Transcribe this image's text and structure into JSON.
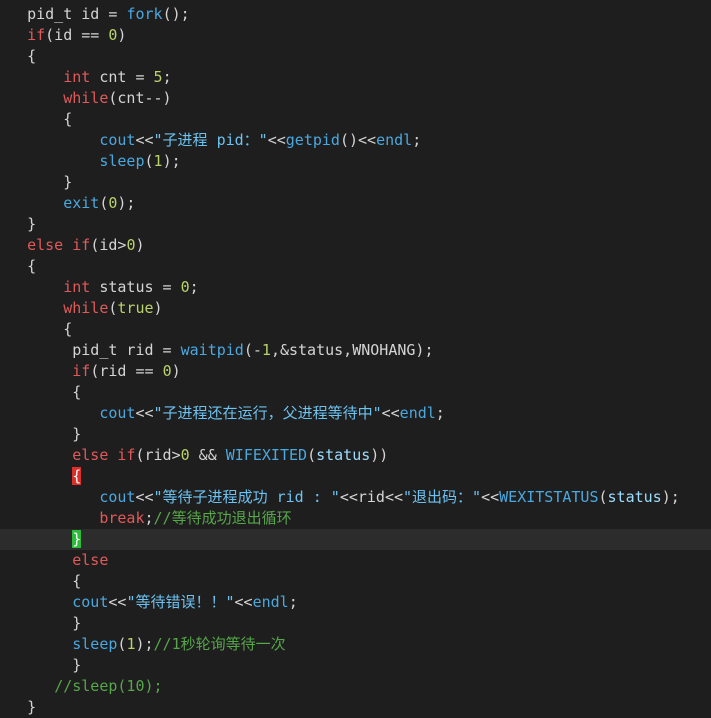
{
  "colors": {
    "background": "#1e1e1e",
    "current_line": "#2c2c2c",
    "plain": "#d4d4d4",
    "keyword": "#e05a5a",
    "function": "#4aa8e0",
    "number": "#b8d36a",
    "string": "#6cc2f0",
    "comment": "#57a64a",
    "bracket_match_open": "#d9302c",
    "bracket_match_close": "#2bbd3a"
  },
  "current_line_index": 25,
  "lines": [
    [
      {
        "t": "   pid_t id = ",
        "c": "pl"
      },
      {
        "t": "fork",
        "c": "fn"
      },
      {
        "t": "();",
        "c": "pl"
      }
    ],
    [
      {
        "t": "   ",
        "c": "pl"
      },
      {
        "t": "if",
        "c": "kw"
      },
      {
        "t": "(id == ",
        "c": "pl"
      },
      {
        "t": "0",
        "c": "num"
      },
      {
        "t": ")",
        "c": "pl"
      }
    ],
    [
      {
        "t": "   {",
        "c": "pl"
      }
    ],
    [
      {
        "t": "       ",
        "c": "pl"
      },
      {
        "t": "int",
        "c": "kw"
      },
      {
        "t": " cnt = ",
        "c": "pl"
      },
      {
        "t": "5",
        "c": "num"
      },
      {
        "t": ";",
        "c": "pl"
      }
    ],
    [
      {
        "t": "       ",
        "c": "pl"
      },
      {
        "t": "while",
        "c": "kw"
      },
      {
        "t": "(cnt--)",
        "c": "pl"
      }
    ],
    [
      {
        "t": "       {",
        "c": "pl"
      }
    ],
    [
      {
        "t": "           ",
        "c": "pl"
      },
      {
        "t": "cout",
        "c": "fn"
      },
      {
        "t": "<<",
        "c": "pl"
      },
      {
        "t": "\"子进程 pid：\"",
        "c": "str"
      },
      {
        "t": "<<",
        "c": "pl"
      },
      {
        "t": "getpid",
        "c": "fn"
      },
      {
        "t": "()<<",
        "c": "pl"
      },
      {
        "t": "endl",
        "c": "fn"
      },
      {
        "t": ";",
        "c": "pl"
      }
    ],
    [
      {
        "t": "           ",
        "c": "pl"
      },
      {
        "t": "sleep",
        "c": "fn"
      },
      {
        "t": "(",
        "c": "pl"
      },
      {
        "t": "1",
        "c": "num"
      },
      {
        "t": ");",
        "c": "pl"
      }
    ],
    [
      {
        "t": "       }",
        "c": "pl"
      }
    ],
    [
      {
        "t": "       ",
        "c": "pl"
      },
      {
        "t": "exit",
        "c": "fn"
      },
      {
        "t": "(",
        "c": "pl"
      },
      {
        "t": "0",
        "c": "num"
      },
      {
        "t": ");",
        "c": "pl"
      }
    ],
    [
      {
        "t": "   }",
        "c": "pl"
      }
    ],
    [
      {
        "t": "   ",
        "c": "pl"
      },
      {
        "t": "else if",
        "c": "kw"
      },
      {
        "t": "(id>",
        "c": "pl"
      },
      {
        "t": "0",
        "c": "num"
      },
      {
        "t": ")",
        "c": "pl"
      }
    ],
    [
      {
        "t": "   {",
        "c": "pl"
      }
    ],
    [
      {
        "t": "       ",
        "c": "pl"
      },
      {
        "t": "int",
        "c": "kw"
      },
      {
        "t": " status = ",
        "c": "pl"
      },
      {
        "t": "0",
        "c": "num"
      },
      {
        "t": ";",
        "c": "pl"
      }
    ],
    [
      {
        "t": "       ",
        "c": "pl"
      },
      {
        "t": "while",
        "c": "kw"
      },
      {
        "t": "(",
        "c": "pl"
      },
      {
        "t": "true",
        "c": "num"
      },
      {
        "t": ")",
        "c": "pl"
      }
    ],
    [
      {
        "t": "       {",
        "c": "pl"
      }
    ],
    [
      {
        "t": "        pid_t rid = ",
        "c": "pl"
      },
      {
        "t": "waitpid",
        "c": "fn"
      },
      {
        "t": "(-",
        "c": "pl"
      },
      {
        "t": "1",
        "c": "num"
      },
      {
        "t": ",&status,WNOHANG);",
        "c": "pl"
      }
    ],
    [
      {
        "t": "        ",
        "c": "pl"
      },
      {
        "t": "if",
        "c": "kw"
      },
      {
        "t": "(rid == ",
        "c": "pl"
      },
      {
        "t": "0",
        "c": "num"
      },
      {
        "t": ")",
        "c": "pl"
      }
    ],
    [
      {
        "t": "        {",
        "c": "pl"
      }
    ],
    [
      {
        "t": "           ",
        "c": "pl"
      },
      {
        "t": "cout",
        "c": "fn"
      },
      {
        "t": "<<",
        "c": "pl"
      },
      {
        "t": "\"子进程还在运行，父进程等待中\"",
        "c": "str"
      },
      {
        "t": "<<",
        "c": "pl"
      },
      {
        "t": "endl",
        "c": "fn"
      },
      {
        "t": ";",
        "c": "pl"
      }
    ],
    [
      {
        "t": "        }",
        "c": "pl"
      }
    ],
    [
      {
        "t": "        ",
        "c": "pl"
      },
      {
        "t": "else if",
        "c": "kw"
      },
      {
        "t": "(rid>",
        "c": "pl"
      },
      {
        "t": "0",
        "c": "num"
      },
      {
        "t": " && ",
        "c": "pl"
      },
      {
        "t": "WIFEXITED",
        "c": "fn"
      },
      {
        "t": "(",
        "c": "pl"
      },
      {
        "t": "status",
        "c": "var"
      },
      {
        "t": "))",
        "c": "pl"
      }
    ],
    [
      {
        "t": "        ",
        "c": "pl"
      },
      {
        "t": "{",
        "c": "br-red"
      }
    ],
    [
      {
        "t": "           ",
        "c": "pl"
      },
      {
        "t": "cout",
        "c": "fn"
      },
      {
        "t": "<<",
        "c": "pl"
      },
      {
        "t": "\"等待子进程成功 rid : \"",
        "c": "str"
      },
      {
        "t": "<<rid<<",
        "c": "pl"
      },
      {
        "t": "\"退出码：\"",
        "c": "str"
      },
      {
        "t": "<<",
        "c": "pl"
      },
      {
        "t": "WEXITSTATUS",
        "c": "fn"
      },
      {
        "t": "(",
        "c": "pl"
      },
      {
        "t": "status",
        "c": "var"
      },
      {
        "t": ");",
        "c": "pl"
      }
    ],
    [
      {
        "t": "           ",
        "c": "pl"
      },
      {
        "t": "break",
        "c": "kw"
      },
      {
        "t": ";",
        "c": "pl"
      },
      {
        "t": "//等待成功退出循环",
        "c": "cm"
      }
    ],
    [
      {
        "t": "        ",
        "c": "pl"
      },
      {
        "t": "}",
        "c": "br-green"
      }
    ],
    [
      {
        "t": "        ",
        "c": "pl"
      },
      {
        "t": "else",
        "c": "kw"
      }
    ],
    [
      {
        "t": "        {",
        "c": "pl"
      }
    ],
    [
      {
        "t": "        ",
        "c": "pl"
      },
      {
        "t": "cout",
        "c": "fn"
      },
      {
        "t": "<<",
        "c": "pl"
      },
      {
        "t": "\"等待错误！！\"",
        "c": "str"
      },
      {
        "t": "<<",
        "c": "pl"
      },
      {
        "t": "endl",
        "c": "fn"
      },
      {
        "t": ";",
        "c": "pl"
      }
    ],
    [
      {
        "t": "        }",
        "c": "pl"
      }
    ],
    [
      {
        "t": "        ",
        "c": "pl"
      },
      {
        "t": "sleep",
        "c": "fn"
      },
      {
        "t": "(",
        "c": "pl"
      },
      {
        "t": "1",
        "c": "num"
      },
      {
        "t": ");",
        "c": "pl"
      },
      {
        "t": "//1秒轮询等待一次",
        "c": "cm"
      }
    ],
    [
      {
        "t": "        }",
        "c": "pl"
      }
    ],
    [
      {
        "t": "      ",
        "c": "pl"
      },
      {
        "t": "//sleep(10);",
        "c": "cm"
      }
    ],
    [
      {
        "t": "   }",
        "c": "pl"
      }
    ]
  ]
}
